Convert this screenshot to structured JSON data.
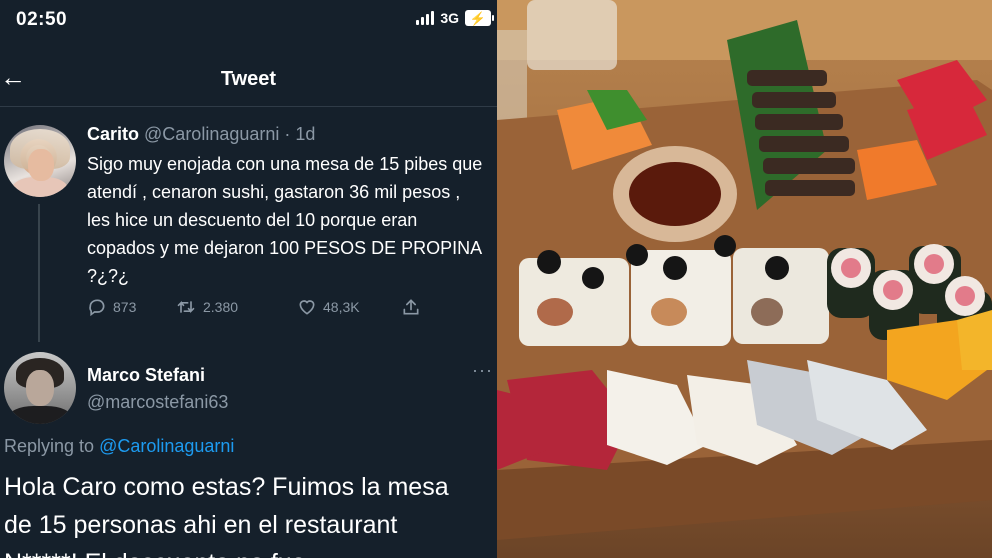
{
  "status_bar": {
    "time": "02:50",
    "network": "3G",
    "battery_icon": "battery-charging-icon"
  },
  "nav": {
    "back_icon": "arrow-left-icon",
    "title": "Tweet"
  },
  "tweet1": {
    "name": "Carito",
    "handle": "@Carolinaguarni",
    "age": "· 1d",
    "text": "Sigo muy enojada con una mesa de 15 pibes que atendí , cenaron sushi, gastaron 36 mil pesos , les hice un descuento del 10 porque eran copados y me dejaron 100 PESOS DE PROPINA ?¿?¿",
    "replies": "873",
    "retweets": "2.380",
    "likes": "48,3K"
  },
  "tweet2": {
    "name": "Marco Stefani",
    "handle": "@marcostefani63",
    "replying_prefix": "Replying to",
    "replying_handle": "@Carolinaguarni",
    "more": "···",
    "text": "Hola Caro como estas? Fuimos la mesa de 15 personas ahi en el restaurant N*****! El descuento no fue..."
  },
  "colors": {
    "background": "#15202b",
    "accent": "#1d9bf0",
    "muted": "#8b98a5"
  }
}
